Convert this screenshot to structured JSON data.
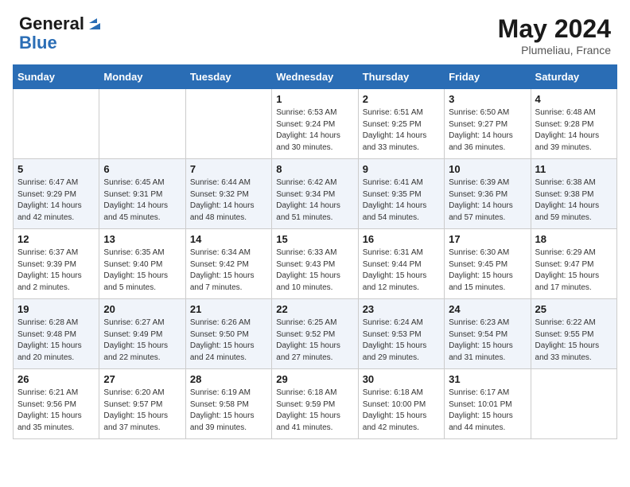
{
  "header": {
    "logo_line1": "General",
    "logo_line2": "Blue",
    "month_year": "May 2024",
    "location": "Plumeliau, France"
  },
  "days_of_week": [
    "Sunday",
    "Monday",
    "Tuesday",
    "Wednesday",
    "Thursday",
    "Friday",
    "Saturday"
  ],
  "weeks": [
    [
      {
        "day": "",
        "sunrise": "",
        "sunset": "",
        "daylight": ""
      },
      {
        "day": "",
        "sunrise": "",
        "sunset": "",
        "daylight": ""
      },
      {
        "day": "",
        "sunrise": "",
        "sunset": "",
        "daylight": ""
      },
      {
        "day": "1",
        "sunrise": "Sunrise: 6:53 AM",
        "sunset": "Sunset: 9:24 PM",
        "daylight": "Daylight: 14 hours and 30 minutes."
      },
      {
        "day": "2",
        "sunrise": "Sunrise: 6:51 AM",
        "sunset": "Sunset: 9:25 PM",
        "daylight": "Daylight: 14 hours and 33 minutes."
      },
      {
        "day": "3",
        "sunrise": "Sunrise: 6:50 AM",
        "sunset": "Sunset: 9:27 PM",
        "daylight": "Daylight: 14 hours and 36 minutes."
      },
      {
        "day": "4",
        "sunrise": "Sunrise: 6:48 AM",
        "sunset": "Sunset: 9:28 PM",
        "daylight": "Daylight: 14 hours and 39 minutes."
      }
    ],
    [
      {
        "day": "5",
        "sunrise": "Sunrise: 6:47 AM",
        "sunset": "Sunset: 9:29 PM",
        "daylight": "Daylight: 14 hours and 42 minutes."
      },
      {
        "day": "6",
        "sunrise": "Sunrise: 6:45 AM",
        "sunset": "Sunset: 9:31 PM",
        "daylight": "Daylight: 14 hours and 45 minutes."
      },
      {
        "day": "7",
        "sunrise": "Sunrise: 6:44 AM",
        "sunset": "Sunset: 9:32 PM",
        "daylight": "Daylight: 14 hours and 48 minutes."
      },
      {
        "day": "8",
        "sunrise": "Sunrise: 6:42 AM",
        "sunset": "Sunset: 9:34 PM",
        "daylight": "Daylight: 14 hours and 51 minutes."
      },
      {
        "day": "9",
        "sunrise": "Sunrise: 6:41 AM",
        "sunset": "Sunset: 9:35 PM",
        "daylight": "Daylight: 14 hours and 54 minutes."
      },
      {
        "day": "10",
        "sunrise": "Sunrise: 6:39 AM",
        "sunset": "Sunset: 9:36 PM",
        "daylight": "Daylight: 14 hours and 57 minutes."
      },
      {
        "day": "11",
        "sunrise": "Sunrise: 6:38 AM",
        "sunset": "Sunset: 9:38 PM",
        "daylight": "Daylight: 14 hours and 59 minutes."
      }
    ],
    [
      {
        "day": "12",
        "sunrise": "Sunrise: 6:37 AM",
        "sunset": "Sunset: 9:39 PM",
        "daylight": "Daylight: 15 hours and 2 minutes."
      },
      {
        "day": "13",
        "sunrise": "Sunrise: 6:35 AM",
        "sunset": "Sunset: 9:40 PM",
        "daylight": "Daylight: 15 hours and 5 minutes."
      },
      {
        "day": "14",
        "sunrise": "Sunrise: 6:34 AM",
        "sunset": "Sunset: 9:42 PM",
        "daylight": "Daylight: 15 hours and 7 minutes."
      },
      {
        "day": "15",
        "sunrise": "Sunrise: 6:33 AM",
        "sunset": "Sunset: 9:43 PM",
        "daylight": "Daylight: 15 hours and 10 minutes."
      },
      {
        "day": "16",
        "sunrise": "Sunrise: 6:31 AM",
        "sunset": "Sunset: 9:44 PM",
        "daylight": "Daylight: 15 hours and 12 minutes."
      },
      {
        "day": "17",
        "sunrise": "Sunrise: 6:30 AM",
        "sunset": "Sunset: 9:45 PM",
        "daylight": "Daylight: 15 hours and 15 minutes."
      },
      {
        "day": "18",
        "sunrise": "Sunrise: 6:29 AM",
        "sunset": "Sunset: 9:47 PM",
        "daylight": "Daylight: 15 hours and 17 minutes."
      }
    ],
    [
      {
        "day": "19",
        "sunrise": "Sunrise: 6:28 AM",
        "sunset": "Sunset: 9:48 PM",
        "daylight": "Daylight: 15 hours and 20 minutes."
      },
      {
        "day": "20",
        "sunrise": "Sunrise: 6:27 AM",
        "sunset": "Sunset: 9:49 PM",
        "daylight": "Daylight: 15 hours and 22 minutes."
      },
      {
        "day": "21",
        "sunrise": "Sunrise: 6:26 AM",
        "sunset": "Sunset: 9:50 PM",
        "daylight": "Daylight: 15 hours and 24 minutes."
      },
      {
        "day": "22",
        "sunrise": "Sunrise: 6:25 AM",
        "sunset": "Sunset: 9:52 PM",
        "daylight": "Daylight: 15 hours and 27 minutes."
      },
      {
        "day": "23",
        "sunrise": "Sunrise: 6:24 AM",
        "sunset": "Sunset: 9:53 PM",
        "daylight": "Daylight: 15 hours and 29 minutes."
      },
      {
        "day": "24",
        "sunrise": "Sunrise: 6:23 AM",
        "sunset": "Sunset: 9:54 PM",
        "daylight": "Daylight: 15 hours and 31 minutes."
      },
      {
        "day": "25",
        "sunrise": "Sunrise: 6:22 AM",
        "sunset": "Sunset: 9:55 PM",
        "daylight": "Daylight: 15 hours and 33 minutes."
      }
    ],
    [
      {
        "day": "26",
        "sunrise": "Sunrise: 6:21 AM",
        "sunset": "Sunset: 9:56 PM",
        "daylight": "Daylight: 15 hours and 35 minutes."
      },
      {
        "day": "27",
        "sunrise": "Sunrise: 6:20 AM",
        "sunset": "Sunset: 9:57 PM",
        "daylight": "Daylight: 15 hours and 37 minutes."
      },
      {
        "day": "28",
        "sunrise": "Sunrise: 6:19 AM",
        "sunset": "Sunset: 9:58 PM",
        "daylight": "Daylight: 15 hours and 39 minutes."
      },
      {
        "day": "29",
        "sunrise": "Sunrise: 6:18 AM",
        "sunset": "Sunset: 9:59 PM",
        "daylight": "Daylight: 15 hours and 41 minutes."
      },
      {
        "day": "30",
        "sunrise": "Sunrise: 6:18 AM",
        "sunset": "Sunset: 10:00 PM",
        "daylight": "Daylight: 15 hours and 42 minutes."
      },
      {
        "day": "31",
        "sunrise": "Sunrise: 6:17 AM",
        "sunset": "Sunset: 10:01 PM",
        "daylight": "Daylight: 15 hours and 44 minutes."
      },
      {
        "day": "",
        "sunrise": "",
        "sunset": "",
        "daylight": ""
      }
    ]
  ]
}
